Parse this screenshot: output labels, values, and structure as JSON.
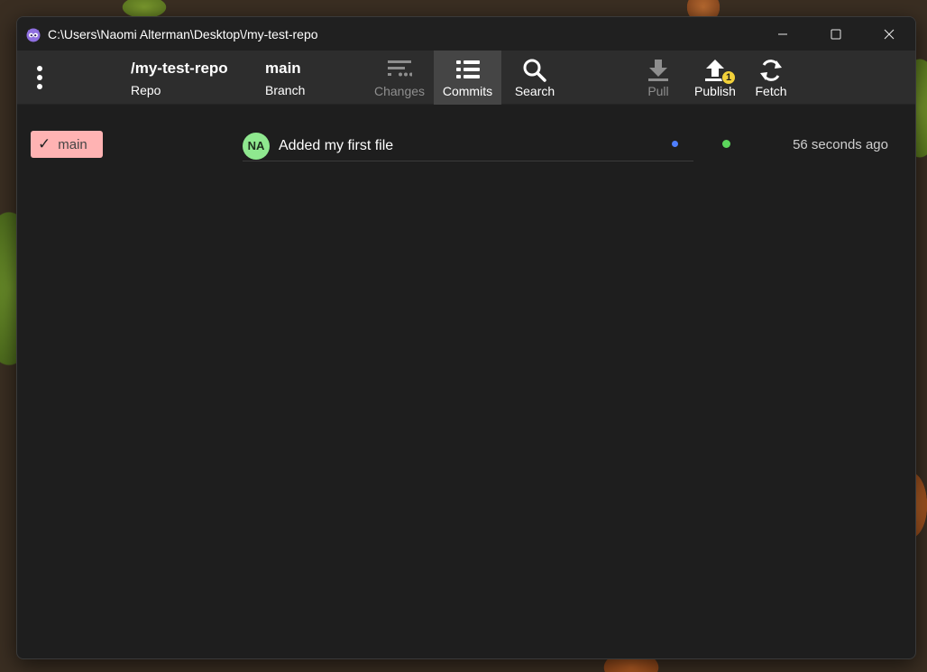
{
  "window": {
    "title": "C:\\Users\\Naomi Alterman\\Desktop\\/my-test-repo",
    "controls": {
      "minimize": "minimize-icon",
      "maximize": "maximize-icon",
      "close": "close-icon"
    }
  },
  "toolbar": {
    "repo": {
      "name": "/my-test-repo",
      "label": "Repo"
    },
    "branch": {
      "name": "main",
      "label": "Branch"
    },
    "buttons": {
      "changes": {
        "label": "Changes",
        "icon": "changes-icon",
        "enabled": false
      },
      "commits": {
        "label": "Commits",
        "icon": "list-icon",
        "active": true
      },
      "search": {
        "label": "Search",
        "icon": "search-icon"
      },
      "pull": {
        "label": "Pull",
        "icon": "download-icon",
        "enabled": false
      },
      "publish": {
        "label": "Publish",
        "icon": "upload-icon",
        "badge": "1"
      },
      "fetch": {
        "label": "Fetch",
        "icon": "refresh-icon"
      }
    }
  },
  "branches": [
    {
      "name": "main",
      "checked": true,
      "color": "#ffb3b3"
    }
  ],
  "commits": [
    {
      "author_initials": "NA",
      "avatar_color": "#8fe88f",
      "message": "Added my first file",
      "time": "56 seconds ago",
      "graph_colors": [
        "#4f7fff",
        "#5cd65c"
      ]
    }
  ]
}
